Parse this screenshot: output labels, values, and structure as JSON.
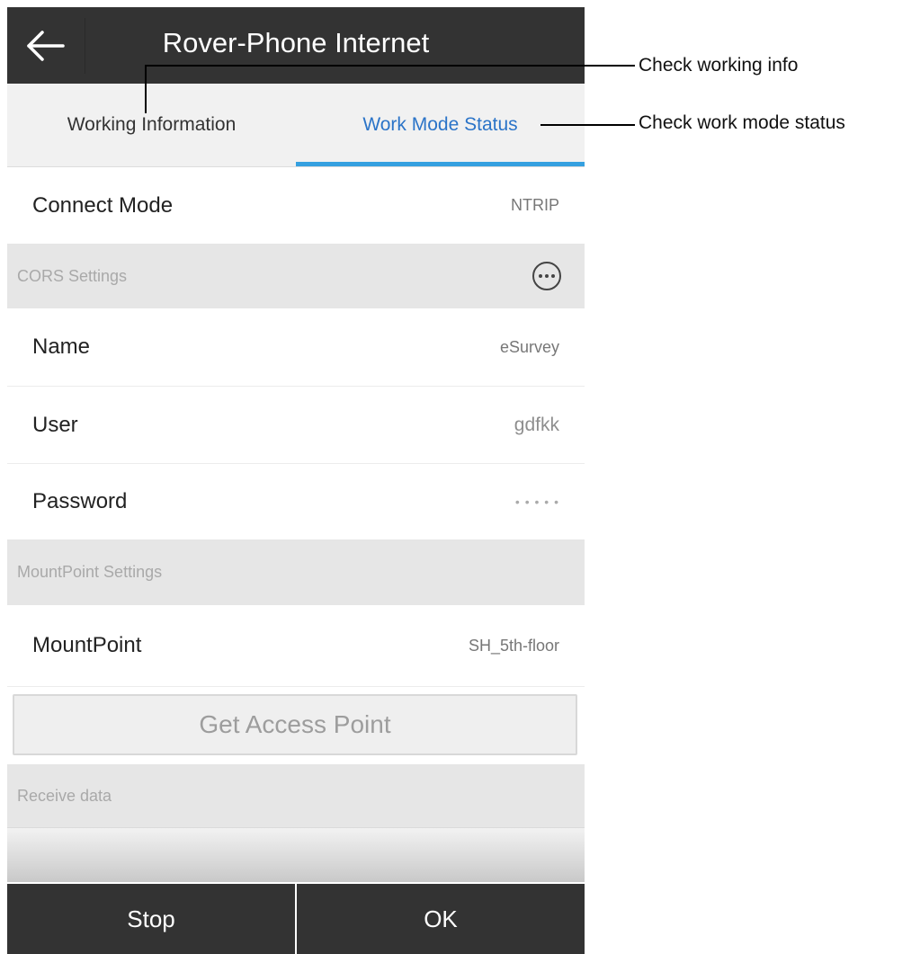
{
  "header": {
    "title": "Rover-Phone Internet",
    "back_icon": "arrow-left-icon"
  },
  "tabs": [
    {
      "label": "Working Information",
      "active": false
    },
    {
      "label": "Work Mode Status",
      "active": true
    }
  ],
  "connect_mode": {
    "label": "Connect Mode",
    "value": "NTRIP"
  },
  "cors_settings": {
    "label": "CORS Settings",
    "more_icon": "more-options-icon"
  },
  "cors_rows": [
    {
      "label": "Name",
      "value": "eSurvey"
    },
    {
      "label": "User",
      "value": "gdfkk"
    },
    {
      "label": "Password",
      "value": "• • • • •"
    }
  ],
  "mountpoint_settings": {
    "label": "MountPoint Settings"
  },
  "mountpoint": {
    "label": "MountPoint",
    "value": "SH_5th-floor"
  },
  "access_button": {
    "label": "Get Access Point"
  },
  "receive": {
    "label": "Receive data"
  },
  "footer": {
    "stop_label": "Stop",
    "ok_label": "OK"
  },
  "callouts": [
    {
      "text": "Check working info"
    },
    {
      "text": "Check work mode status"
    }
  ],
  "colors": {
    "header_bg": "#333333",
    "active_tab_text": "#2b74c8",
    "active_tab_underline": "#35a0e0",
    "section_bg": "#e6e6e6"
  }
}
